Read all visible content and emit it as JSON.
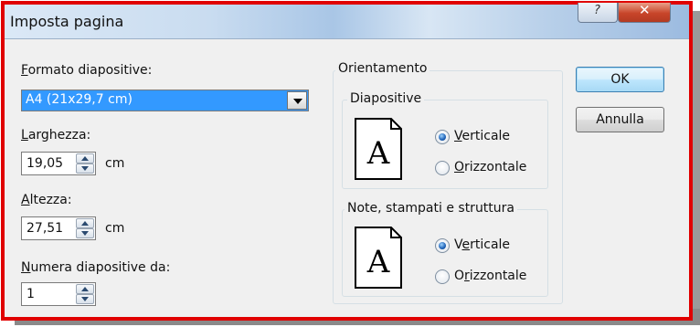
{
  "window": {
    "title": "Imposta pagina",
    "help_glyph": "?",
    "close_glyph": "✕"
  },
  "left": {
    "format_label": "Formato diapositive:",
    "format_value": "A4 (21x29,7 cm)",
    "width_label": "Larghezza:",
    "width_value": "19,05",
    "width_unit": "cm",
    "height_label": "Altezza:",
    "height_value": "27,51",
    "height_unit": "cm",
    "number_label": "Numera diapositive da:",
    "number_value": "1"
  },
  "orientation": {
    "title": "Orientamento",
    "slides": {
      "title": "Diapositive",
      "icon_letter": "A",
      "options": [
        "Verticale",
        "Orizzontale"
      ],
      "selected": "Verticale"
    },
    "notes": {
      "title": "Note, stampati e struttura",
      "icon_letter": "A",
      "options": [
        "Verticale",
        "Orizzontale"
      ],
      "selected": "Verticale"
    }
  },
  "buttons": {
    "ok": "OK",
    "cancel": "Annulla"
  },
  "colors": {
    "highlight_border": "#e00000",
    "selection": "#3399ff"
  }
}
